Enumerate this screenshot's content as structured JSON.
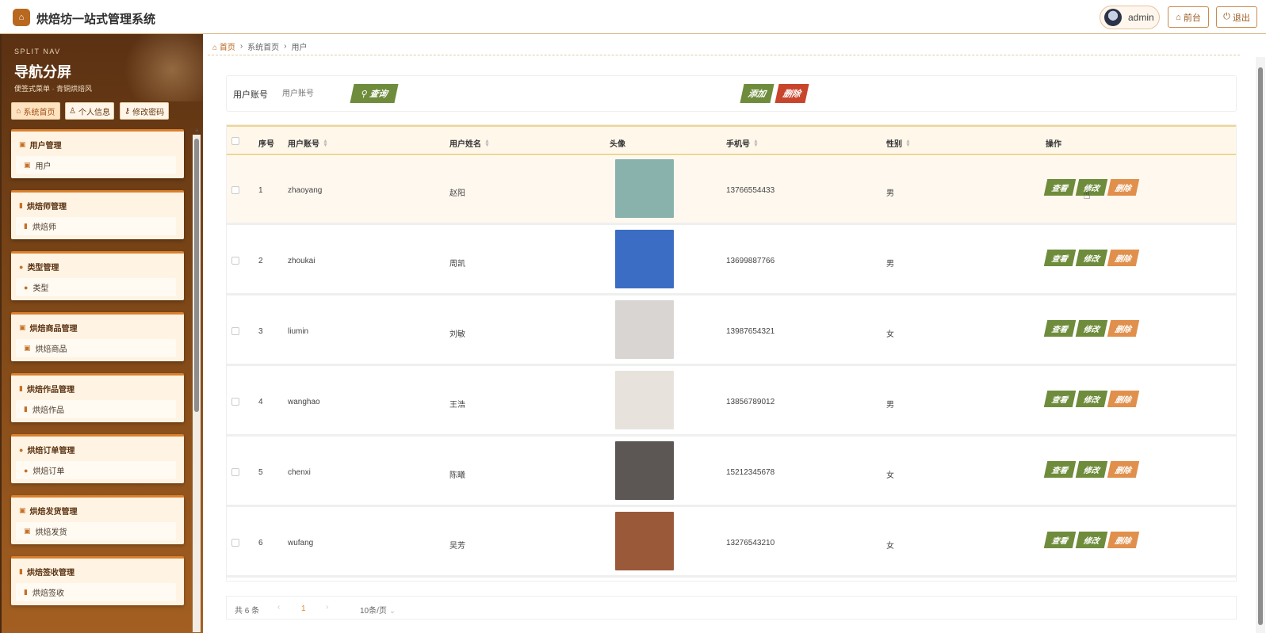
{
  "app": {
    "title": "烘焙坊一站式管理系统",
    "user": "admin",
    "front_label": "前台",
    "logout_label": "退出"
  },
  "sidebar": {
    "kicker": "SPLIT NAV",
    "title": "导航分屏",
    "subtitle": "便签式菜单 · 青铜烘焙风",
    "quick": [
      {
        "label": "系统首页",
        "icon": "home-icon"
      },
      {
        "label": "个人信息",
        "icon": "user-icon"
      },
      {
        "label": "修改密码",
        "icon": "key-icon"
      }
    ],
    "groups": [
      {
        "title": "用户管理",
        "item": "用户",
        "icon": "briefcase-icon"
      },
      {
        "title": "烘焙师管理",
        "item": "烘焙师",
        "icon": "chart-icon"
      },
      {
        "title": "类型管理",
        "item": "类型",
        "icon": "pin-icon"
      },
      {
        "title": "烘焙商品管理",
        "item": "烘焙商品",
        "icon": "briefcase-icon"
      },
      {
        "title": "烘焙作品管理",
        "item": "烘焙作品",
        "icon": "chart-icon"
      },
      {
        "title": "烘焙订单管理",
        "item": "烘焙订单",
        "icon": "pin-icon"
      },
      {
        "title": "烘焙发货管理",
        "item": "烘焙发货",
        "icon": "briefcase-icon"
      },
      {
        "title": "烘焙签收管理",
        "item": "烘焙签收",
        "icon": "chart-icon"
      }
    ]
  },
  "breadcrumb": [
    "首页",
    "系统首页",
    "用户"
  ],
  "search": {
    "label": "用户账号",
    "placeholder": "用户账号",
    "query_label": "查询",
    "add_label": "添加",
    "delete_label": "删除"
  },
  "table": {
    "headers": [
      "序号",
      "用户账号",
      "用户姓名",
      "头像",
      "手机号",
      "性别",
      "操作"
    ],
    "actions": {
      "view": "查看",
      "edit": "修改",
      "delete": "删除"
    },
    "rows": [
      {
        "no": "1",
        "account": "zhaoyang",
        "name": "赵阳",
        "phone": "13766554433",
        "gender": "男",
        "color": "#89b2ad"
      },
      {
        "no": "2",
        "account": "zhoukai",
        "name": "周凯",
        "phone": "13699887766",
        "gender": "男",
        "color": "#3b6dc4"
      },
      {
        "no": "3",
        "account": "liumin",
        "name": "刘敏",
        "phone": "13987654321",
        "gender": "女",
        "color": "#d9d5d2"
      },
      {
        "no": "4",
        "account": "wanghao",
        "name": "王浩",
        "phone": "13856789012",
        "gender": "男",
        "color": "#e8e2dc"
      },
      {
        "no": "5",
        "account": "chenxi",
        "name": "陈曦",
        "phone": "15212345678",
        "gender": "女",
        "color": "#5c5755"
      },
      {
        "no": "6",
        "account": "wufang",
        "name": "吴芳",
        "phone": "13276543210",
        "gender": "女",
        "color": "#9a5a3a"
      }
    ]
  },
  "pagination": {
    "total": "共 6 条",
    "current": "1",
    "size": "10条/页"
  }
}
